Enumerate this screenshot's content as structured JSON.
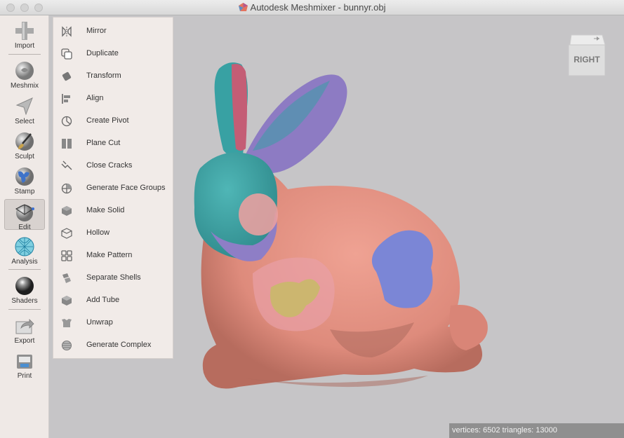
{
  "window": {
    "title": "Autodesk Meshmixer - bunnyr.obj"
  },
  "toolbar": {
    "tools": [
      {
        "label": "Import",
        "icon": "plus-icon"
      },
      {
        "label": "Meshmix",
        "icon": "meshmix-sphere-icon"
      },
      {
        "label": "Select",
        "icon": "arrow-cursor-icon"
      },
      {
        "label": "Sculpt",
        "icon": "brush-icon"
      },
      {
        "label": "Stamp",
        "icon": "stamp-icon"
      },
      {
        "label": "Edit",
        "icon": "edit-mesh-icon",
        "active": true
      },
      {
        "label": "Analysis",
        "icon": "analysis-mesh-icon"
      },
      {
        "label": "Shaders",
        "icon": "shader-sphere-icon"
      },
      {
        "label": "Export",
        "icon": "export-icon"
      },
      {
        "label": "Print",
        "icon": "printer-icon"
      }
    ]
  },
  "edit_menu": {
    "items": [
      {
        "label": "Mirror",
        "icon": "mirror-icon"
      },
      {
        "label": "Duplicate",
        "icon": "duplicate-icon"
      },
      {
        "label": "Transform",
        "icon": "transform-icon"
      },
      {
        "label": "Align",
        "icon": "align-icon"
      },
      {
        "label": "Create Pivot",
        "icon": "pivot-icon"
      },
      {
        "label": "Plane Cut",
        "icon": "plane-cut-icon"
      },
      {
        "label": "Close Cracks",
        "icon": "close-cracks-icon"
      },
      {
        "label": "Generate Face Groups",
        "icon": "face-groups-icon"
      },
      {
        "label": "Make Solid",
        "icon": "make-solid-icon"
      },
      {
        "label": "Hollow",
        "icon": "hollow-icon"
      },
      {
        "label": "Make Pattern",
        "icon": "pattern-icon"
      },
      {
        "label": "Separate Shells",
        "icon": "separate-shells-icon"
      },
      {
        "label": "Add Tube",
        "icon": "tube-icon"
      },
      {
        "label": "Unwrap",
        "icon": "unwrap-icon"
      },
      {
        "label": "Generate Complex",
        "icon": "complex-icon"
      }
    ]
  },
  "viewport": {
    "view_cube_label": "RIGHT",
    "model_name": "bunnyr.obj"
  },
  "status": {
    "text": "vertices: 6502  triangles: 13000"
  },
  "colors": {
    "skin": "#e08c7d",
    "teal": "#3aa2a2",
    "purple": "#8e7ec6",
    "blue": "#7b86d6",
    "yellow": "#c9b96a",
    "background": "#c6c5c7"
  }
}
